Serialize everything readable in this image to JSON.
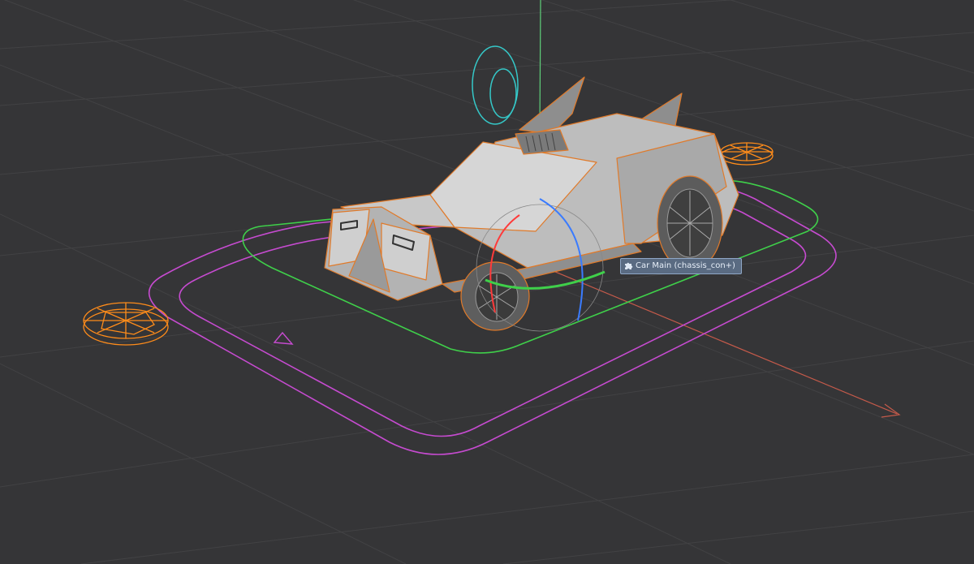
{
  "viewport": {
    "background": "#353537",
    "grid_color": "#444446",
    "axis_colors": {
      "x": "#c55a4a",
      "y": "#5fd07a",
      "z": "#4a7fd8"
    }
  },
  "selected_object": {
    "name": "Car Main (chassis_con+)",
    "outline_color": "#e07a2a",
    "icon": "puzzle-piece-icon"
  },
  "controls": {
    "root_control_color": "#c64bd0",
    "body_control_color": "#3fd04a",
    "wheel_control_color": "#ff8c1a",
    "rotation_gizmo_colors": [
      "#ff3a3a",
      "#3fd04a",
      "#3a7bff",
      "#35c8c8"
    ]
  }
}
